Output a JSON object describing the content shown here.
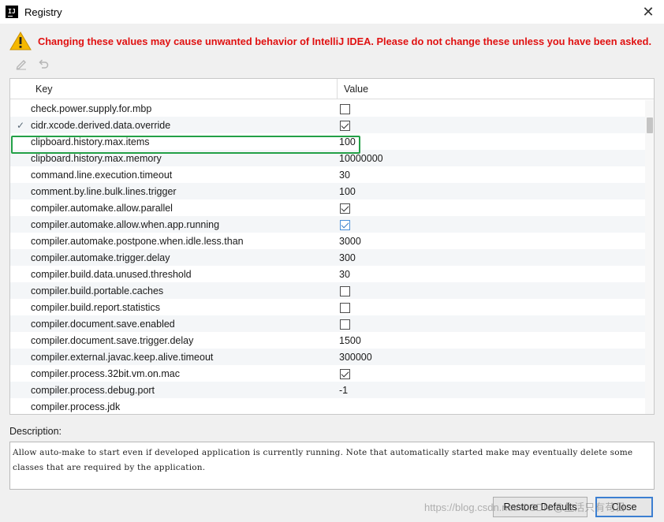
{
  "window": {
    "title": "Registry",
    "app_icon": "IJ",
    "close_glyph": "✕"
  },
  "warning": {
    "text": "Changing these values may cause unwanted behavior of IntelliJ IDEA. Please do not change these unless you have been asked.",
    "color": "#e01010"
  },
  "toolbar": {
    "edit_icon": "pencil-icon",
    "revert_icon": "undo-icon"
  },
  "table": {
    "col_key": "Key",
    "col_value": "Value",
    "rows": [
      {
        "modified": false,
        "key": "check.power.supply.for.mbp",
        "type": "bool",
        "checked": false
      },
      {
        "modified": true,
        "key": "cidr.xcode.derived.data.override",
        "type": "bool",
        "checked": true
      },
      {
        "modified": false,
        "key": "clipboard.history.max.items",
        "type": "text",
        "value": "100"
      },
      {
        "modified": false,
        "key": "clipboard.history.max.memory",
        "type": "text",
        "value": "10000000"
      },
      {
        "modified": false,
        "key": "command.line.execution.timeout",
        "type": "text",
        "value": "30"
      },
      {
        "modified": false,
        "key": "comment.by.line.bulk.lines.trigger",
        "type": "text",
        "value": "100"
      },
      {
        "modified": false,
        "key": "compiler.automake.allow.parallel",
        "type": "bool",
        "checked": true
      },
      {
        "modified": false,
        "key": "compiler.automake.allow.when.app.running",
        "type": "bool",
        "checked": true,
        "selected": true
      },
      {
        "modified": false,
        "key": "compiler.automake.postpone.when.idle.less.than",
        "type": "text",
        "value": "3000"
      },
      {
        "modified": false,
        "key": "compiler.automake.trigger.delay",
        "type": "text",
        "value": "300"
      },
      {
        "modified": false,
        "key": "compiler.build.data.unused.threshold",
        "type": "text",
        "value": "30"
      },
      {
        "modified": false,
        "key": "compiler.build.portable.caches",
        "type": "bool",
        "checked": false
      },
      {
        "modified": false,
        "key": "compiler.build.report.statistics",
        "type": "bool",
        "checked": false
      },
      {
        "modified": false,
        "key": "compiler.document.save.enabled",
        "type": "bool",
        "checked": false
      },
      {
        "modified": false,
        "key": "compiler.document.save.trigger.delay",
        "type": "text",
        "value": "1500"
      },
      {
        "modified": false,
        "key": "compiler.external.javac.keep.alive.timeout",
        "type": "text",
        "value": "300000"
      },
      {
        "modified": false,
        "key": "compiler.process.32bit.vm.on.mac",
        "type": "bool",
        "checked": true
      },
      {
        "modified": false,
        "key": "compiler.process.debug.port",
        "type": "text",
        "value": "-1"
      },
      {
        "modified": false,
        "key": "compiler.process.jdk",
        "type": "text",
        "value": ""
      }
    ],
    "highlight_color": "#23a047"
  },
  "description": {
    "label": "Description:",
    "text": "Allow auto-make to start even if developed application is currently running. Note that automatically started make may eventually delete some classes that are required by the application."
  },
  "buttons": {
    "restore": "Restore Defaults",
    "close": "Close"
  },
  "watermark": "https://blog.csdn.net/ CSDN @生活只有苟日"
}
